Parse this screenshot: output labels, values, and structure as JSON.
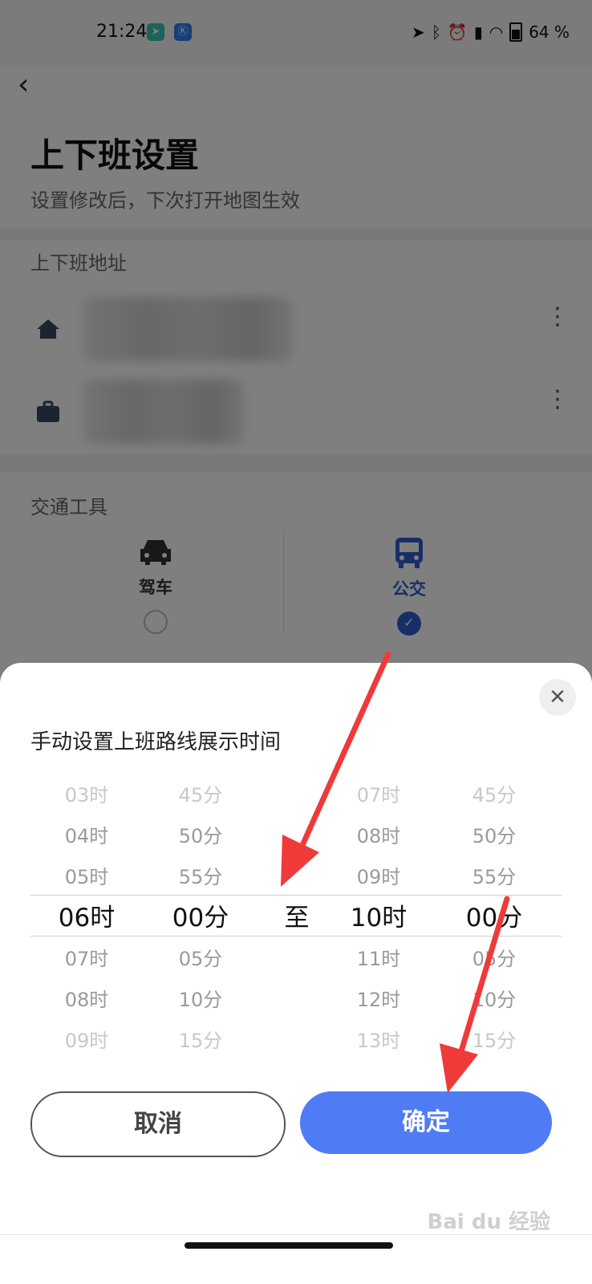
{
  "status_bar": {
    "time": "21:24",
    "battery": "64 %"
  },
  "header": {
    "title": "上下班设置",
    "subtitle": "设置修改后，下次打开地图生效"
  },
  "address_section": {
    "label": "上下班地址",
    "rows": [
      {
        "icon": "home-icon"
      },
      {
        "icon": "briefcase-icon"
      }
    ]
  },
  "transport_section": {
    "label": "交通工具",
    "options": [
      {
        "label": "驾车",
        "icon": "car-icon",
        "selected": false
      },
      {
        "label": "公交",
        "icon": "bus-icon",
        "selected": true
      }
    ]
  },
  "sheet": {
    "title": "手动设置上班路线展示时间",
    "start_hour": [
      "03时",
      "04时",
      "05时",
      "06时",
      "07时",
      "08时",
      "09时"
    ],
    "start_minute": [
      "45分",
      "50分",
      "55分",
      "00分",
      "05分",
      "10分",
      "15分"
    ],
    "separator": "至",
    "end_hour": [
      "07时",
      "08时",
      "09时",
      "10时",
      "11时",
      "12时",
      "13时"
    ],
    "end_minute": [
      "45分",
      "50分",
      "55分",
      "00分",
      "05分",
      "10分",
      "15分"
    ],
    "cancel_label": "取消",
    "confirm_label": "确定"
  },
  "watermark": "Bai du 经验",
  "colors": {
    "accent_blue": "#4f7cf5",
    "selected_blue": "#2f5fd0",
    "arrow_red": "#f03a3a"
  }
}
